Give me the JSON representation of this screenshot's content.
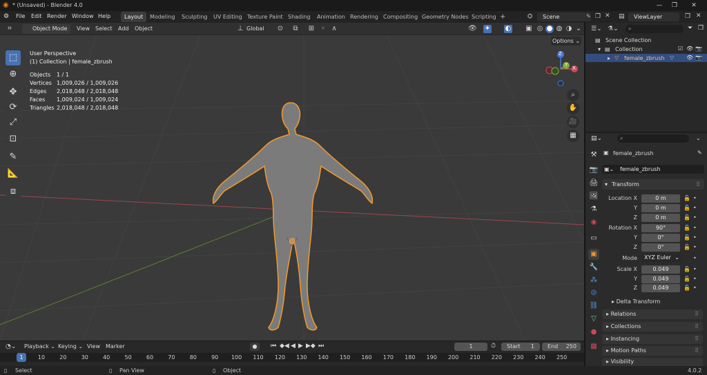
{
  "window": {
    "title": "* (Unsaved) - Blender 4.0",
    "controls": [
      "—",
      "❐",
      "✕"
    ]
  },
  "menubar": {
    "items": [
      "File",
      "Edit",
      "Render",
      "Window",
      "Help"
    ]
  },
  "workspaces": {
    "tabs": [
      "Layout",
      "Modeling",
      "Sculpting",
      "UV Editing",
      "Texture Paint",
      "Shading",
      "Animation",
      "Rendering",
      "Compositing",
      "Geometry Nodes",
      "Scripting"
    ],
    "active": "Layout",
    "add": "+"
  },
  "scene": {
    "name": "Scene",
    "view_layer": "ViewLayer"
  },
  "viewport_header": {
    "mode": "Object Mode",
    "menus": [
      "View",
      "Select",
      "Add",
      "Object"
    ],
    "transform_orientation": "Global",
    "options": "Options"
  },
  "viewport_overlay": {
    "perspective": "User Perspective",
    "collection_line": "(1) Collection | female_zbrush",
    "stats": [
      {
        "label": "Objects",
        "value": "1 / 1"
      },
      {
        "label": "Vertices",
        "value": "1,009,026 / 1,009,026"
      },
      {
        "label": "Edges",
        "value": "2,018,048 / 2,018,048"
      },
      {
        "label": "Faces",
        "value": "1,009,024 / 1,009,024"
      },
      {
        "label": "Triangles",
        "value": "2,018,048 / 2,018,048"
      }
    ],
    "gizmo": {
      "x": "X",
      "y": "Y",
      "z": "Z"
    }
  },
  "outliner": {
    "search_placeholder": "",
    "scene_collection": "Scene Collection",
    "collection": "Collection",
    "object": "female_zbrush"
  },
  "properties": {
    "object_name": "female_zbrush",
    "data_name": "female_zbrush",
    "transform": {
      "header": "Transform",
      "location_label": "Location X",
      "location": [
        "0 m",
        "0 m",
        "0 m"
      ],
      "rotation_label": "Rotation X",
      "rotation": [
        "90°",
        "0°",
        "0°"
      ],
      "mode_label": "Mode",
      "mode": "XYZ Euler",
      "scale_label": "Scale X",
      "scale": [
        "0.049",
        "0.049",
        "0.049"
      ],
      "y": "Y",
      "z": "Z"
    },
    "sections": [
      "Delta Transform",
      "Relations",
      "Collections",
      "Instancing",
      "Motion Paths",
      "Visibility"
    ]
  },
  "timeline": {
    "menus": [
      "Playback",
      "Keying",
      "View",
      "Marker"
    ],
    "current_frame": "1",
    "start_label": "Start",
    "start": "1",
    "end_label": "End",
    "end": "250",
    "ticks": [
      "1",
      "10",
      "20",
      "30",
      "40",
      "50",
      "60",
      "70",
      "80",
      "90",
      "100",
      "110",
      "120",
      "130",
      "140",
      "150",
      "160",
      "170",
      "180",
      "190",
      "200",
      "210",
      "220",
      "230",
      "240",
      "250"
    ]
  },
  "statusbar": {
    "select": "Select",
    "pan": "Pan View",
    "object": "Object",
    "version": "4.0.2"
  },
  "colors": {
    "accent": "#4772b3",
    "selection_outline": "#f29a2e",
    "axis_x": "#c94a5a",
    "axis_y": "#7fb03a",
    "axis_z": "#4a78d8"
  }
}
